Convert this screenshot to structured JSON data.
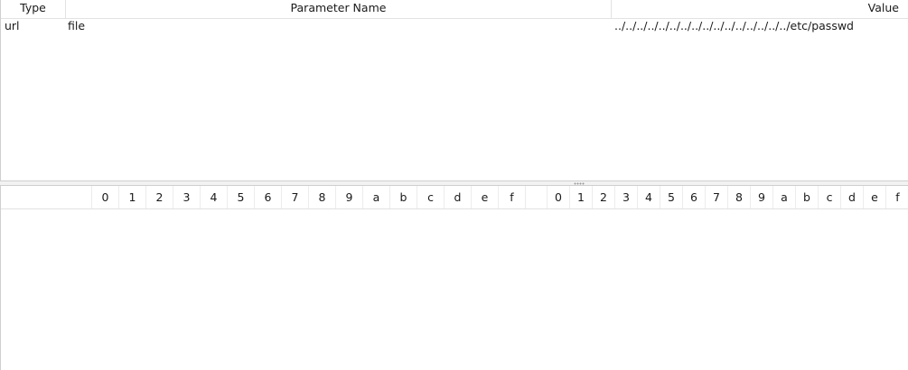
{
  "params": {
    "headers": {
      "type": "Type",
      "name": "Parameter Name",
      "value": "Value"
    },
    "rows": [
      {
        "type": "url",
        "name": "file",
        "value": "../../../../../../../../../../../../../../../../etc/passwd"
      }
    ]
  },
  "hex": {
    "hex_columns": [
      "0",
      "1",
      "2",
      "3",
      "4",
      "5",
      "6",
      "7",
      "8",
      "9",
      "a",
      "b",
      "c",
      "d",
      "e",
      "f"
    ],
    "ascii_columns": [
      "0",
      "1",
      "2",
      "3",
      "4",
      "5",
      "6",
      "7",
      "8",
      "9",
      "a",
      "b",
      "c",
      "d",
      "e",
      "f"
    ]
  }
}
